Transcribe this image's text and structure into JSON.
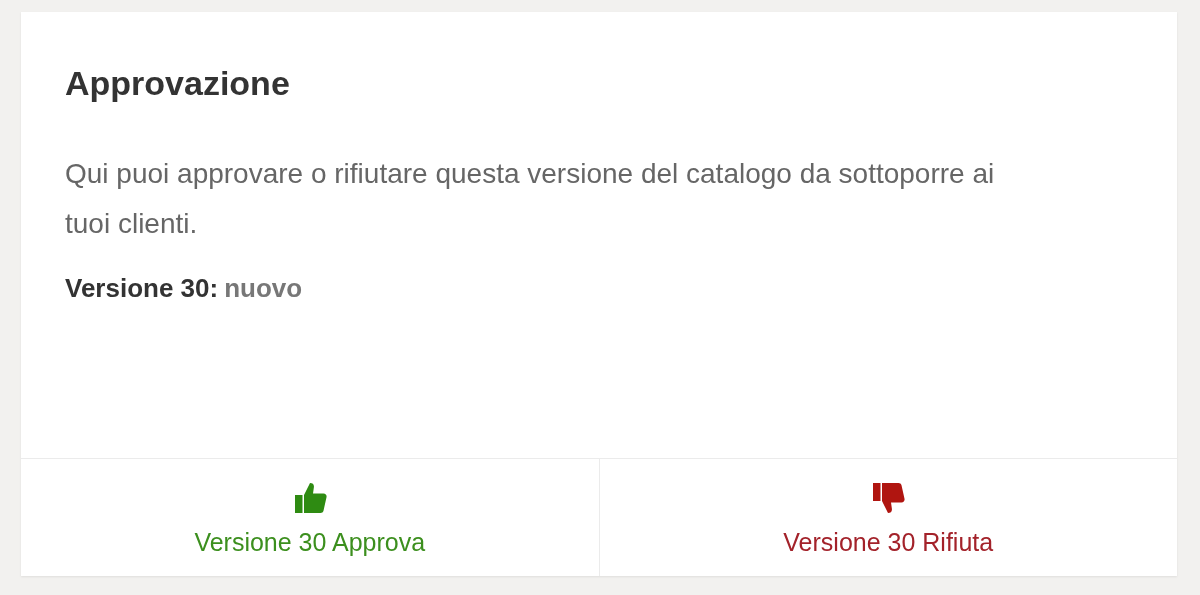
{
  "card": {
    "title": "Approvazione",
    "description": "Qui puoi approvare o rifiutare questa versione del catalogo da sottoporre ai tuoi clienti.",
    "version_label": "Versione 30:",
    "version_status": "nuovo"
  },
  "actions": [
    {
      "kind": "approve",
      "label": "Versione 30 Approva"
    },
    {
      "kind": "reject",
      "label": "Versione 30 Rifiuta"
    }
  ]
}
